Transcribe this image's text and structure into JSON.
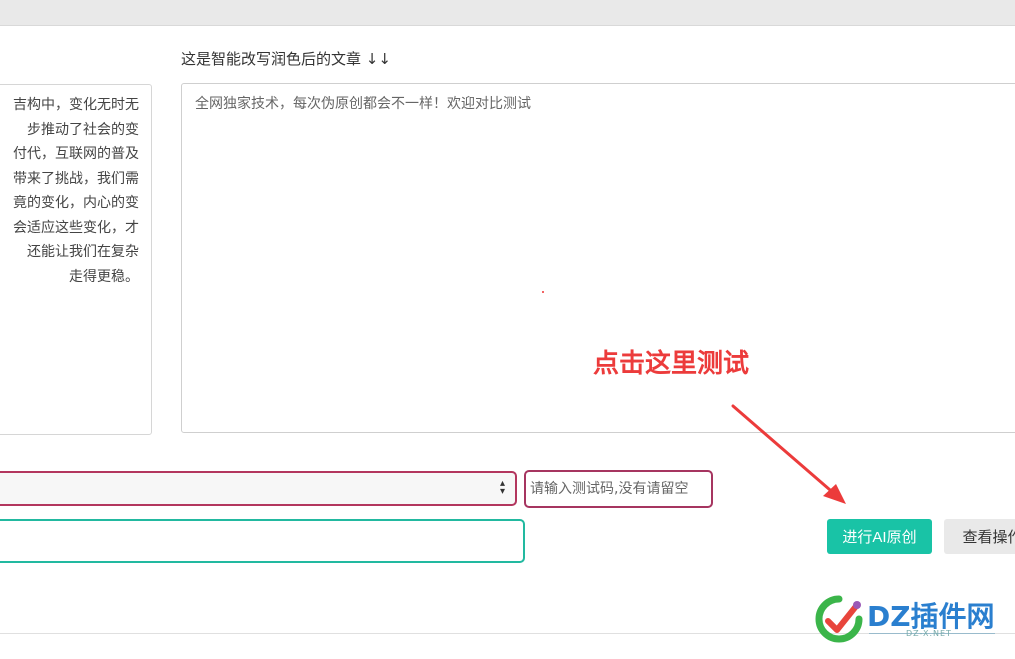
{
  "output_section": {
    "label": "这是智能改写润色后的文章 ↓↓",
    "content": "全网独家技术，每次伪原创都会不一样！欢迎对比测试"
  },
  "input_section": {
    "lines": [
      "吉构中，变化无时无",
      "步推动了社会的变",
      "付代，互联网的普及",
      "带来了挑战，我们需",
      "竟的变化，内心的变",
      "会适应这些变化，才",
      "还能让我们在复杂",
      "走得更稳。"
    ]
  },
  "annotation": {
    "text": "点击这里测试",
    "color": "#ec3b3b"
  },
  "controls": {
    "select_value": "",
    "code_placeholder": "请输入测试码,没有请留空",
    "primary_button": "进行AI原创",
    "secondary_button": "查看操作"
  },
  "watermark": {
    "text": "DZ插件网",
    "sub": "DZ-X.NET"
  },
  "colors": {
    "accent_green": "#19c3a6",
    "select_border": "#b3365e",
    "annotation_red": "#ec3b3b"
  }
}
